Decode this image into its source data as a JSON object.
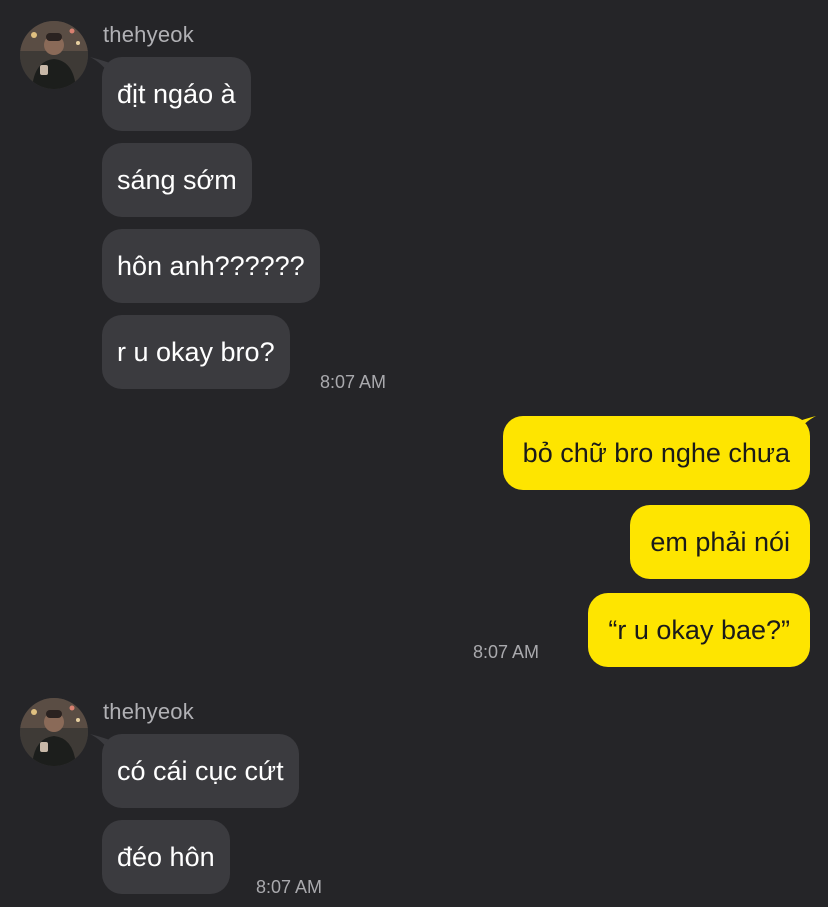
{
  "colors": {
    "background": "#252528",
    "incoming_bubble": "#3b3b3f",
    "outgoing_bubble": "#fee500",
    "sender_name": "#b1b1b5",
    "timestamp": "#a9a9ad"
  },
  "group1": {
    "sender": "thehyeok",
    "messages": [
      "địt ngáo à",
      "sáng sớm",
      "hôn anh??????",
      "r u okay bro?"
    ],
    "time": "8:07 AM"
  },
  "outgoing": {
    "messages": [
      "bỏ chữ bro nghe chưa",
      "em phải nói",
      "“r u okay bae?”"
    ],
    "time": "8:07 AM"
  },
  "group2": {
    "sender": "thehyeok",
    "messages": [
      "có cái cục cứt",
      "đéo hôn"
    ],
    "time": "8:07 AM"
  }
}
